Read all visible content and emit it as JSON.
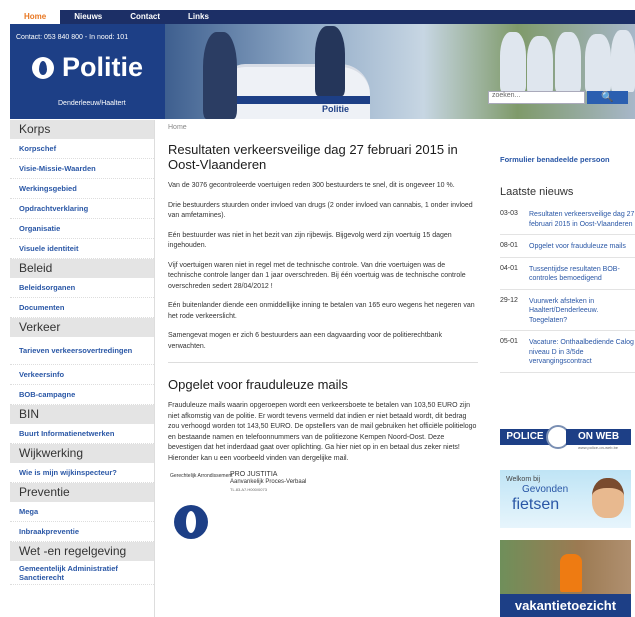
{
  "nav": [
    "Home",
    "Nieuws",
    "Contact",
    "Links"
  ],
  "header": {
    "contact": "Contact: 053 840 800 - In nood: 101",
    "logo": "Politie",
    "subtitle": "Denderleeuw/Haaltert",
    "car_label": "Politie"
  },
  "search": {
    "placeholder": "zoeken...",
    "button": "🔍"
  },
  "sidebar": [
    {
      "category": "Korps",
      "items": [
        "Korpschef",
        "Visie-Missie-Waarden",
        "Werkingsgebied",
        "Opdrachtverklaring",
        "Organisatie",
        "Visuele identiteit"
      ]
    },
    {
      "category": "Beleid",
      "items": [
        "Beleidsorganen",
        "Documenten"
      ]
    },
    {
      "category": "Verkeer",
      "items": [
        "Tarieven verkeersovertredingen",
        "Verkeersinfo",
        "BOB-campagne"
      ]
    },
    {
      "category": "BIN",
      "items": [
        "Buurt Informatienetwerken"
      ]
    },
    {
      "category": "Wijkwerking",
      "items": [
        "Wie is mijn wijkinspecteur?"
      ]
    },
    {
      "category": "Preventie",
      "items": [
        "Mega",
        "Inbraakpreventie"
      ]
    },
    {
      "category": "Wet -en regelgeving",
      "items": [
        "Gemeentelijk Administratief Sanctierecht"
      ]
    }
  ],
  "breadcrumb": "Home",
  "article1": {
    "title": "Resultaten verkeersveilige dag 27 februari 2015 in Oost-Vlaanderen",
    "paragraphs": [
      "Van de 3076 gecontroleerde voertuigen reden 300 bestuurders te snel, dit is ongeveer 10 %.",
      "Drie bestuurders stuurden onder invloed van drugs (2 onder invloed van cannabis, 1 onder invloed van amfetamines).",
      "Eén bestuurder was niet in het bezit van zijn rijbewijs. Bijgevolg werd zijn voertuig 15 dagen ingehouden.",
      "Vijf voertuigen waren niet in regel met de technische controle. Van drie voertuigen was de technische controle langer dan 1 jaar overschreden. Bij één voertuig was de technische controle overschreden sedert 28/04/2012 !",
      "Eén buitenlander diende een onmiddellijke inning te betalen van 165 euro wegens het negeren van het rode verkeerslicht.",
      "Samengevat mogen er zich 6 bestuurders aan een dagvaarding voor de politierechtbank verwachten."
    ]
  },
  "article2": {
    "title": "Opgelet voor frauduleuze mails",
    "paragraph": "Frauduleuze mails waarin opgeroepen wordt een verkeersboete te betalen van 103,50 EURO zijn niet afkomstig van de politie. Er wordt tevens vermeld dat indien er niet betaald wordt, dit bedrag zou verhoogd worden tot 143,50 EURO. De opstellers van de mail gebruiken het officiële politielogo en bestaande namen en telefoonnummers van de politiezone Kempen Noord-Oost. Deze bevestigen dat het inderdaad gaat over oplichting. Ga hier niet op in en betaal dus zeker niets! Hieronder kan u een voorbeeld vinden van dergelijke mail.",
    "letter": {
      "left": "Gerechtelijk Arrondissement",
      "title": "PRO JUSTITIA",
      "subtitle": "Aanvankelijk Proces-Verbaal",
      "ref": "TL.83.A7.H000/0073"
    }
  },
  "right": {
    "form_link": "Formulier benadeelde persoon",
    "news_title": "Laatste nieuws",
    "news": [
      {
        "date": "03-03",
        "text": "Resultaten verkeersveilige dag 27 februari 2015 in Oost-Vlaanderen"
      },
      {
        "date": "08-01",
        "text": "Opgelet voor frauduleuze mails"
      },
      {
        "date": "04-01",
        "text": "Tussentijdse resultaten BOB-controles bemoedigend"
      },
      {
        "date": "29-12",
        "text": "Vuurwerk afsteken in Haaltert/Denderleeuw. Toegelaten?"
      },
      {
        "date": "05-01",
        "text": "Vacature: Onthaalbediende Calog niveau D in 3/5de vervangingscontract"
      }
    ],
    "banner_pow": {
      "left": "POLICE",
      "right": "ON WEB",
      "url": "www.police-on-web.be"
    },
    "banner_fietsen": {
      "small": "Welkom bij",
      "mid": "Gevonden",
      "big": "fietsen"
    },
    "banner_vakantie": "vakantietoezicht"
  }
}
